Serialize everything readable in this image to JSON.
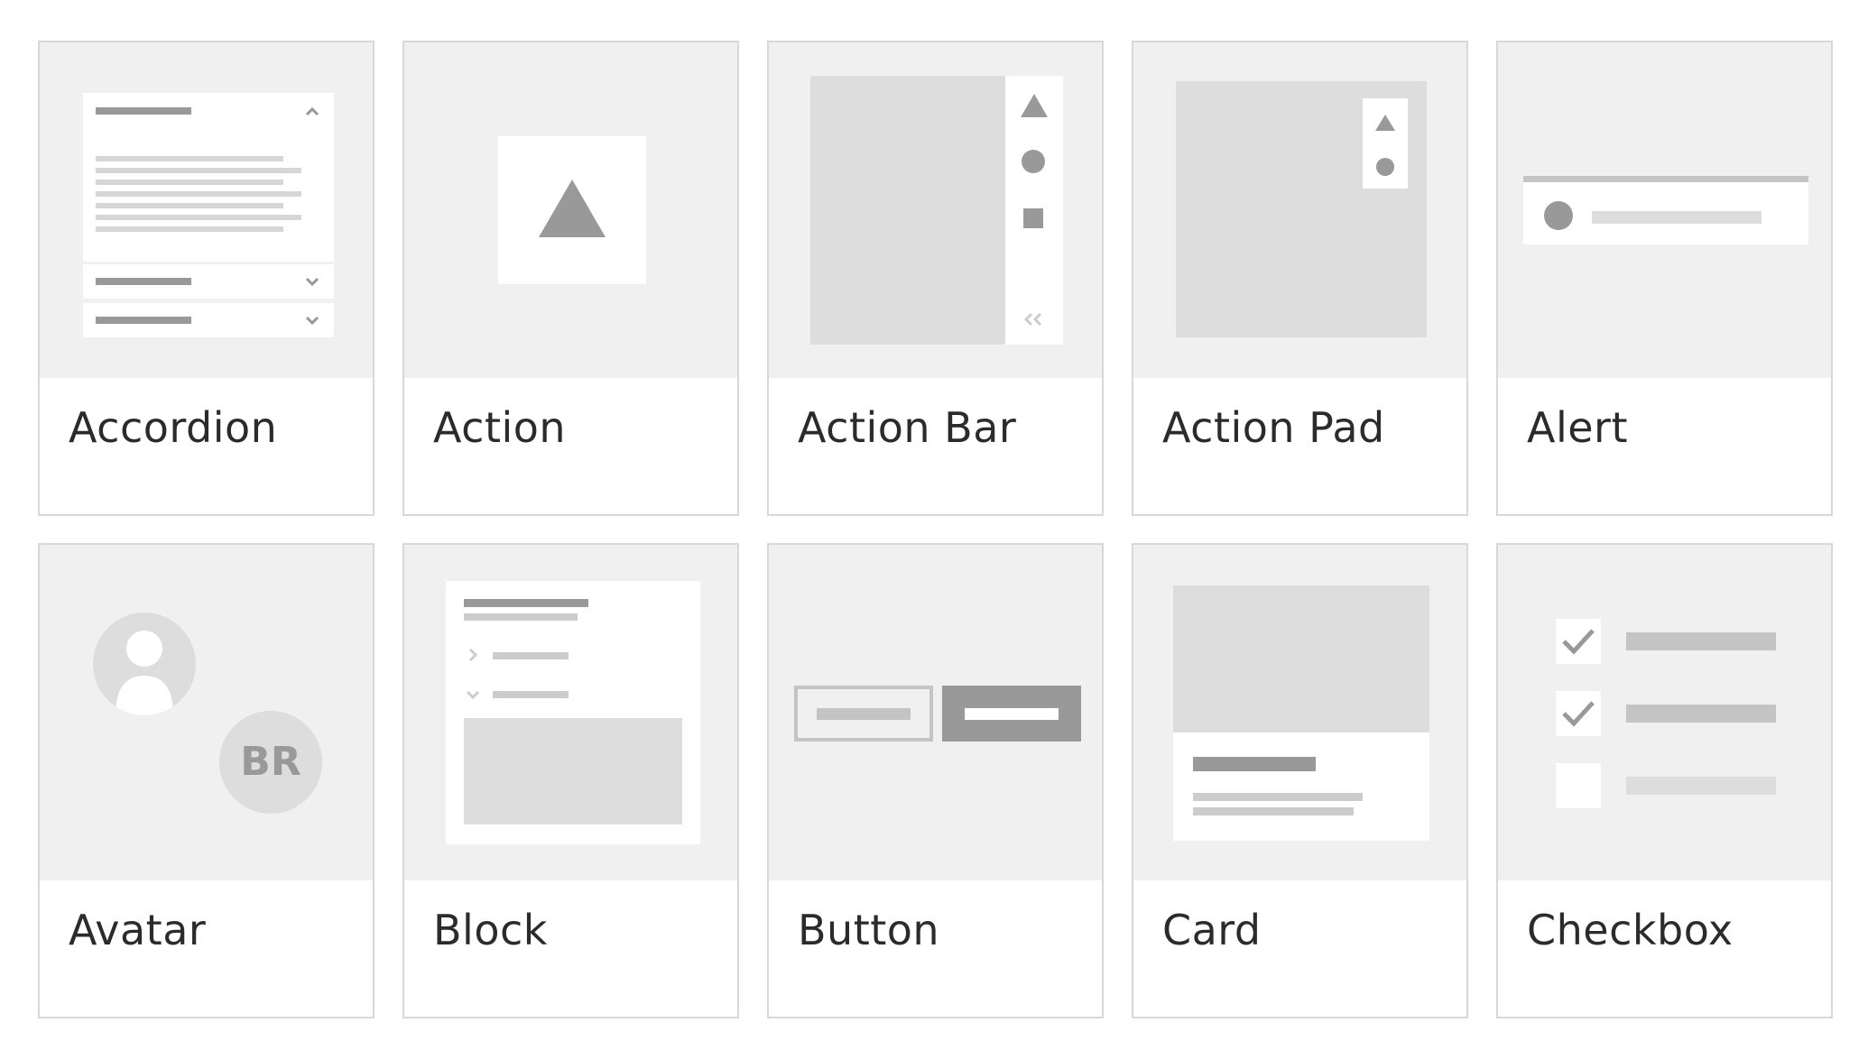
{
  "components": [
    {
      "name": "Accordion"
    },
    {
      "name": "Action"
    },
    {
      "name": "Action Bar"
    },
    {
      "name": "Action Pad"
    },
    {
      "name": "Alert"
    },
    {
      "name": "Avatar",
      "avatar_initials": "BR"
    },
    {
      "name": "Block"
    },
    {
      "name": "Button"
    },
    {
      "name": "Card"
    },
    {
      "name": "Checkbox"
    }
  ],
  "colors": {
    "page_background": "#ffffff",
    "card_border": "#d8d8d8",
    "thumbnail_background": "#f0f0f0",
    "placeholder_dark": "#999999",
    "placeholder_light": "#dddddd",
    "label_text": "#2b2b2b"
  },
  "checkbox_demo": {
    "checked": [
      true,
      true,
      false
    ]
  }
}
